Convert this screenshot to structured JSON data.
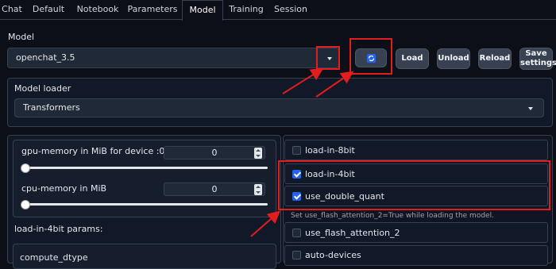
{
  "tabs": [
    "Chat",
    "Default",
    "Notebook",
    "Parameters",
    "Model",
    "Training",
    "Session"
  ],
  "active_tab": "Model",
  "model": {
    "label": "Model",
    "selected": "openchat_3.5",
    "buttons": {
      "refresh": "refresh-icon",
      "load": "Load",
      "unload": "Unload",
      "reload": "Reload",
      "save_line1": "Save",
      "save_line2": "settings"
    }
  },
  "loader": {
    "label": "Model loader",
    "selected": "Transformers"
  },
  "memory": {
    "gpu_label": "gpu-memory in MiB for device :0",
    "gpu_value": "0",
    "gpu_level": 0,
    "cpu_label": "cpu-memory in MiB",
    "cpu_value": "0",
    "cpu_level": 0
  },
  "params": {
    "title": "load-in-4bit params:",
    "compute_dtype": "compute_dtype"
  },
  "options": {
    "load_in_8bit": {
      "label": "load-in-8bit",
      "checked": false
    },
    "load_in_4bit": {
      "label": "load-in-4bit",
      "checked": true
    },
    "use_double_quant": {
      "label": "use_double_quant",
      "checked": true
    },
    "flash_hint": "Set use_flash_attention_2=True while loading the model.",
    "use_flash_attention_2": {
      "label": "use_flash_attention_2",
      "checked": false
    },
    "auto_devices": {
      "label": "auto-devices",
      "checked": false
    }
  },
  "colors": {
    "background": "#0c0f17",
    "panel": "#111827",
    "accent": "#2563eb",
    "annotation": "#e11d1d"
  }
}
